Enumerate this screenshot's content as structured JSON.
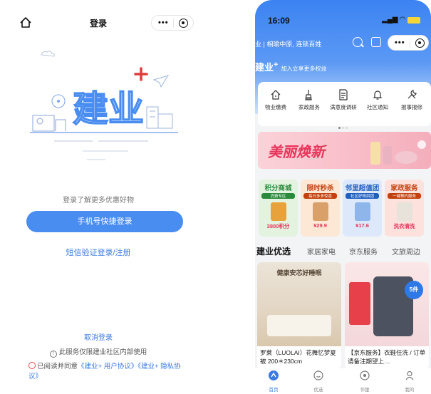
{
  "left": {
    "title": "登录",
    "hint": "登录了解更多优惠好物",
    "phone_login": "手机号快捷登录",
    "sms_login": "短信验证登录/注册",
    "cancel": "取消登录",
    "notice": "此服务仅限建业社区内部使用",
    "agree_prefix": "已阅读并同意",
    "user_agreement": "《建业+ 用户协议》",
    "privacy_policy": "《建业+ 隐私协议》",
    "illustration_text": "建业"
  },
  "right": {
    "time": "16:09",
    "city_text": "业 | 相瑜中原, 连锁百姓",
    "brand": "建业",
    "brand_plus": "+",
    "brand_sub": "加入立享更多权益",
    "services": [
      {
        "label": "物业缴费",
        "icon": "house-icon"
      },
      {
        "label": "家政服务",
        "icon": "broom-icon"
      },
      {
        "label": "满意度调研",
        "icon": "survey-icon"
      },
      {
        "label": "社区通知",
        "icon": "bell-icon"
      },
      {
        "label": "报事报修",
        "icon": "wrench-icon"
      }
    ],
    "banner": "美丽焕新",
    "promos": [
      {
        "title": "积分商城",
        "sub": "消费专区",
        "price": "3800积分",
        "color": "#2a8a3c",
        "bg": "#e3f3e0"
      },
      {
        "title": "限时秒杀",
        "sub": "每日多多惊喜",
        "price": "¥29.9",
        "color": "#c2410c",
        "bg": "#fde8d6"
      },
      {
        "title": "邻里超值团",
        "sub": "社区好物拼团",
        "price": "¥17.6",
        "color": "#1e5fbf",
        "bg": "#dde9fb"
      },
      {
        "title": "家政服务",
        "sub": "一键预约服务",
        "price": "洗衣清洗",
        "color": "#c2410c",
        "bg": "#fde1dd"
      }
    ],
    "tabs": [
      "建业优选",
      "家居家电",
      "京东服务",
      "文旅周边"
    ],
    "products": [
      {
        "title": "罗莱（LUOLAI）花舞忆梦夏被 200＊230cm",
        "img_text": "健康安芯好睡眠"
      },
      {
        "title": "【京东服务】衣鞋任洗 / 订单请备注期望上…",
        "img_text": "5件"
      }
    ],
    "bottom_nav": [
      {
        "label": "首页",
        "icon": "home-icon"
      },
      {
        "label": "优选",
        "icon": "smile-icon"
      },
      {
        "label": "邻里",
        "icon": "chat-icon"
      },
      {
        "label": "我的",
        "icon": "user-icon"
      }
    ]
  }
}
